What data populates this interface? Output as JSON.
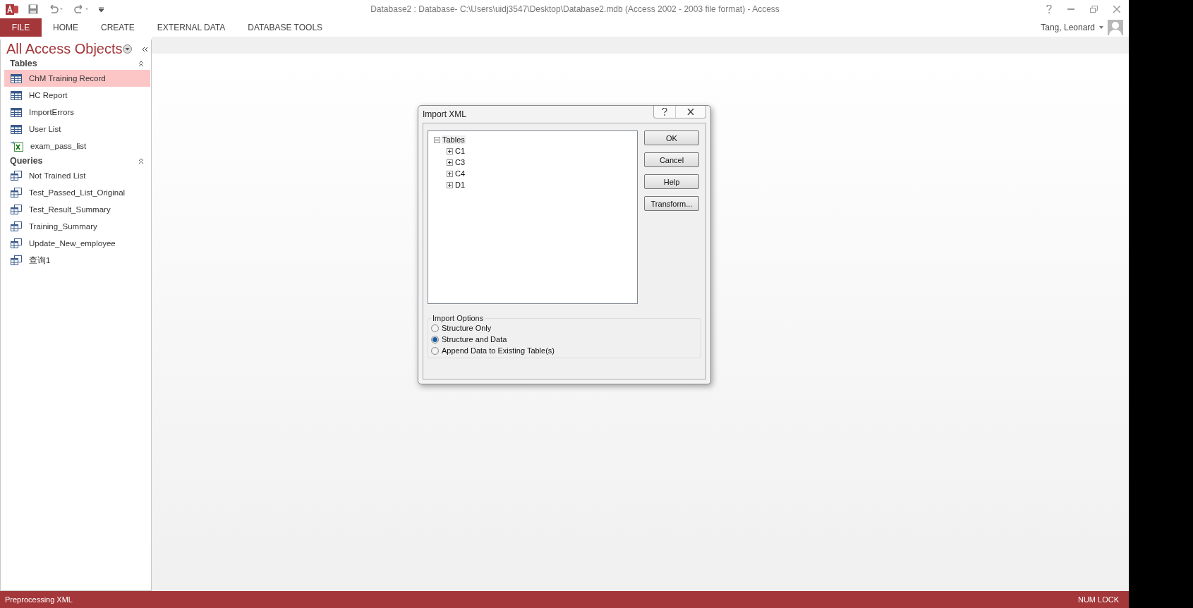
{
  "app": {
    "title": "Database2 : Database- C:\\Users\\uidj3547\\Desktop\\Database2.mdb (Access 2002 - 2003 file format) - Access"
  },
  "ribbon": {
    "file_tab": "FILE",
    "tabs": [
      "HOME",
      "CREATE",
      "EXTERNAL DATA",
      "DATABASE TOOLS"
    ]
  },
  "account": {
    "name": "Tang, Leonard"
  },
  "navigation": {
    "title": "All Access Objects",
    "groups": [
      {
        "label": "Tables",
        "expanded": true,
        "items": [
          {
            "label": "ChM Training Record",
            "kind": "table",
            "selected": true
          },
          {
            "label": "HC Report",
            "kind": "table",
            "selected": false
          },
          {
            "label": "ImportErrors",
            "kind": "table",
            "selected": false
          },
          {
            "label": "User List",
            "kind": "table",
            "selected": false
          },
          {
            "label": "exam_pass_list",
            "kind": "excel",
            "selected": false
          }
        ]
      },
      {
        "label": "Queries",
        "expanded": true,
        "items": [
          {
            "label": "Not Trained List",
            "kind": "query",
            "selected": false
          },
          {
            "label": "Test_Passed_List_Original",
            "kind": "query",
            "selected": false
          },
          {
            "label": "Test_Result_Summary",
            "kind": "query",
            "selected": false
          },
          {
            "label": "Training_Summary",
            "kind": "query",
            "selected": false
          },
          {
            "label": "Update_New_employee",
            "kind": "query",
            "selected": false
          },
          {
            "label": "查询1",
            "kind": "query",
            "selected": false
          }
        ]
      }
    ]
  },
  "dialog": {
    "title": "Import XML",
    "tree": {
      "label": "Tables",
      "expanded": true,
      "selected": true,
      "children": [
        {
          "label": "C1",
          "expanded": false,
          "selected": false
        },
        {
          "label": "C3",
          "expanded": false,
          "selected": false
        },
        {
          "label": "C4",
          "expanded": false,
          "selected": false
        },
        {
          "label": "D1",
          "expanded": false,
          "selected": false
        }
      ]
    },
    "buttons": [
      "OK",
      "Cancel",
      "Help",
      "Transform..."
    ],
    "options": {
      "title": "Import Options",
      "items": [
        {
          "label": "Structure Only",
          "selected": false
        },
        {
          "label": "Structure and Data",
          "selected": true
        },
        {
          "label": "Append Data to Existing Table(s)",
          "selected": false
        }
      ]
    }
  },
  "status_bar": {
    "message": "Preprocessing XML",
    "indicator": "NUM LOCK"
  }
}
